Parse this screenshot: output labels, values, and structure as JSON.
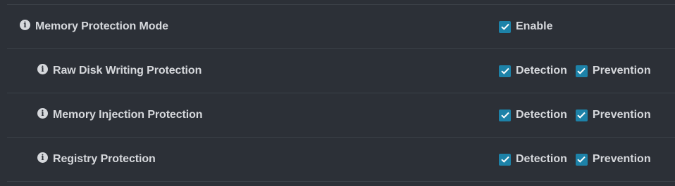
{
  "settings": {
    "rows": [
      {
        "label": "Memory Protection Mode",
        "options": [
          {
            "label": "Enable",
            "checked": true
          }
        ]
      },
      {
        "label": "Raw Disk Writing Protection",
        "options": [
          {
            "label": "Detection",
            "checked": true
          },
          {
            "label": "Prevention",
            "checked": true
          }
        ]
      },
      {
        "label": "Memory Injection Protection",
        "options": [
          {
            "label": "Detection",
            "checked": true
          },
          {
            "label": "Prevention",
            "checked": true
          }
        ]
      },
      {
        "label": "Registry Protection",
        "options": [
          {
            "label": "Detection",
            "checked": true
          },
          {
            "label": "Prevention",
            "checked": true
          }
        ]
      }
    ],
    "info_icon_glyph": "i",
    "colors": {
      "background": "#2c3037",
      "divider": "#3b4048",
      "text": "#d6d8dc",
      "checkbox": "#1d82a8"
    }
  }
}
